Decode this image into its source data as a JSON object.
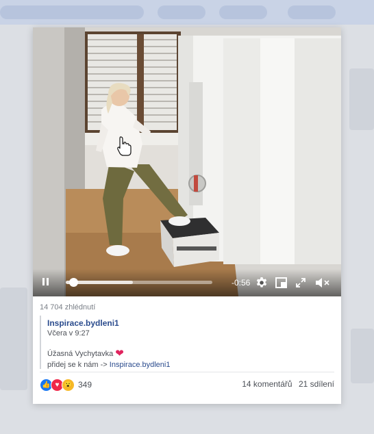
{
  "video": {
    "time_remaining": "-0:56",
    "progress": 0.05,
    "buffered": 0.46,
    "controls": {
      "pause_icon": "pause-icon",
      "settings_icon": "gear-icon",
      "pip_icon": "picture-in-picture-icon",
      "fullscreen_icon": "fullscreen-icon",
      "volume_icon": "volume-muted-icon"
    }
  },
  "post": {
    "views": "14 704 zhlédnutí",
    "page_name": "Inspirace.bydleni1",
    "timestamp": "Včera v 9:27",
    "text": "Úžasná Vychytavka",
    "join_text": "přidej se k nám ->",
    "join_link": "Inspirace.bydleni1",
    "reaction_count": "349",
    "comments": "14 komentářů",
    "shares": "21 sdílení"
  },
  "colors": {
    "link": "#2a4b8d",
    "like": "#1877f2",
    "love": "#f0284a",
    "wow": "#f7b928"
  }
}
